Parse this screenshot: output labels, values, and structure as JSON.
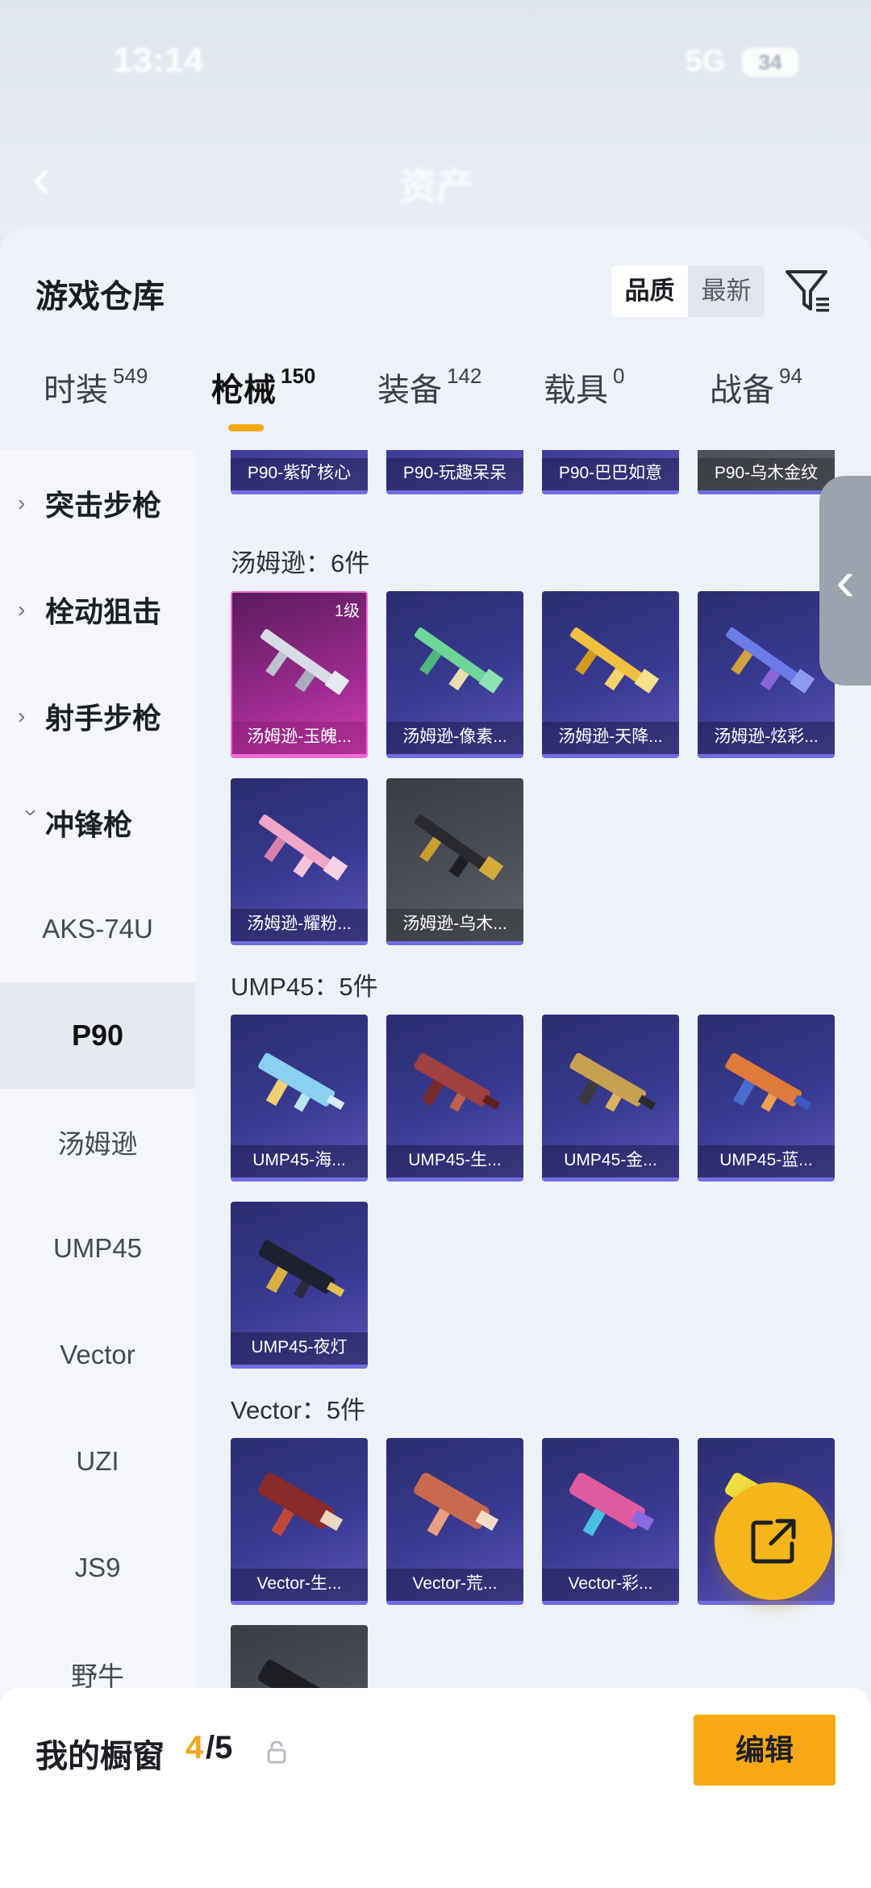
{
  "status": {
    "time": "13:14",
    "network": "5G",
    "battery": "34"
  },
  "header": {
    "title": "资产"
  },
  "panel": {
    "title": "游戏仓库",
    "sort": [
      "品质",
      "最新"
    ],
    "tabs": [
      {
        "label": "时装",
        "count": "549"
      },
      {
        "label": "枪械",
        "count": "150"
      },
      {
        "label": "装备",
        "count": "142"
      },
      {
        "label": "载具",
        "count": "0"
      },
      {
        "label": "战备",
        "count": "94"
      }
    ]
  },
  "sidebar": {
    "categories": [
      "突击步枪",
      "栓动狙击",
      "射手步枪",
      "冲锋枪"
    ],
    "items": [
      "AKS-74U",
      "P90",
      "汤姆逊",
      "UMP45",
      "Vector",
      "UZI",
      "JS9",
      "野牛"
    ]
  },
  "content": {
    "p90_cards": [
      "P90-紫矿核心",
      "P90-玩趣呆呆",
      "P90-巴巴如意",
      "P90-乌木金纹"
    ],
    "thompson": {
      "title": "汤姆逊：6件",
      "level": "1级",
      "cards": [
        "汤姆逊-玉魄...",
        "汤姆逊-像素...",
        "汤姆逊-天降...",
        "汤姆逊-炫彩...",
        "汤姆逊-耀粉...",
        "汤姆逊-乌木..."
      ]
    },
    "ump45": {
      "title": "UMP45：5件",
      "cards": [
        "UMP45-海...",
        "UMP45-生...",
        "UMP45-金...",
        "UMP45-蓝...",
        "UMP45-夜灯"
      ]
    },
    "vector": {
      "title": "Vector：5件",
      "cards": [
        "Vector-生...",
        "Vector-荒...",
        "Vector-彩..."
      ]
    }
  },
  "bottom": {
    "label": "我的橱窗",
    "current": "4",
    "total": "/5",
    "edit": "编辑"
  },
  "icons": {
    "filter": "filter-icon",
    "share": "share-icon",
    "lock": "lock-icon",
    "back": "back-arrow-icon"
  },
  "colors": {
    "accent": "#f5b61a",
    "card_blue": "#3a3a92",
    "card_pink": "#9c2a8e"
  }
}
